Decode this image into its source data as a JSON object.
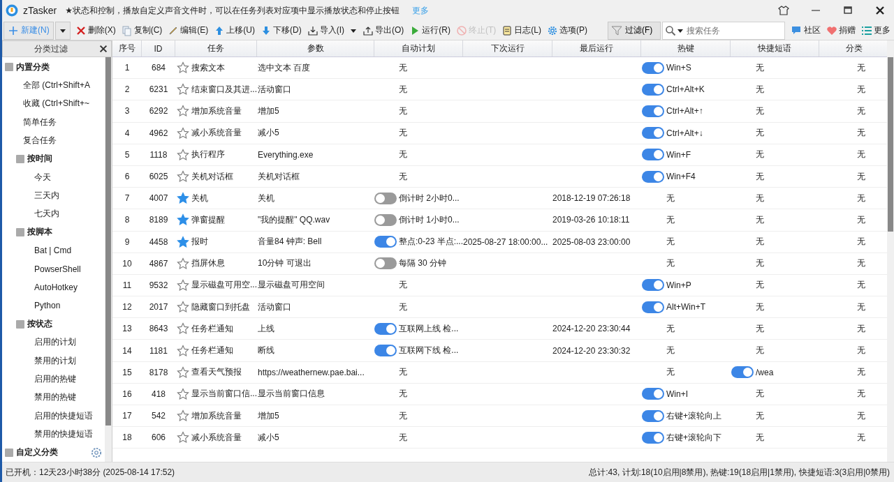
{
  "window": {
    "app_name": "zTasker",
    "news": "★状态和控制，播放自定义声音文件时，可以在任务列表对应项中显示播放状态和停止按钮",
    "news_link": "更多"
  },
  "toolbar": {
    "items": [
      {
        "label": "新建(N)",
        "disabled": false
      },
      {
        "label": "删除(X)",
        "disabled": false
      },
      {
        "label": "复制(C)",
        "disabled": false
      },
      {
        "label": "编辑(E)",
        "disabled": false
      },
      {
        "label": "上移(U)",
        "disabled": false
      },
      {
        "label": "下移(D)",
        "disabled": false
      },
      {
        "label": "导入(I)",
        "disabled": false
      },
      {
        "label": "导出(O)",
        "disabled": false
      },
      {
        "label": "运行(R)",
        "disabled": false
      },
      {
        "label": "终止(T)",
        "disabled": true
      },
      {
        "label": "日志(L)",
        "disabled": false
      },
      {
        "label": "选项(P)",
        "disabled": false
      }
    ],
    "filter": "过滤(F)",
    "search_placeholder": "搜索任务",
    "links": [
      "社区",
      "捐赠",
      "更多"
    ]
  },
  "sidebar": {
    "title": "分类过滤",
    "tree": [
      {
        "label": "内置分类",
        "children": [
          {
            "label": "全部 (Ctrl+Shift+A"
          },
          {
            "label": "收藏 (Ctrl+Shift+~"
          },
          {
            "label": "简单任务"
          },
          {
            "label": "复合任务"
          },
          {
            "label": "按时间",
            "children": [
              {
                "label": "今天"
              },
              {
                "label": "三天内"
              },
              {
                "label": "七天内"
              }
            ]
          },
          {
            "label": "按脚本",
            "children": [
              {
                "label": "Bat | Cmd"
              },
              {
                "label": "PowserShell"
              },
              {
                "label": "AutoHotkey"
              },
              {
                "label": "Python"
              }
            ]
          },
          {
            "label": "按状态",
            "children": [
              {
                "label": "启用的计划"
              },
              {
                "label": "禁用的计划"
              },
              {
                "label": "启用的热键"
              },
              {
                "label": "禁用的热键"
              },
              {
                "label": "启用的快捷短语"
              },
              {
                "label": "禁用的快捷短语"
              }
            ]
          }
        ]
      },
      {
        "label": "自定义分类"
      }
    ]
  },
  "table": {
    "columns": [
      "序号",
      "ID",
      "任务",
      "参数",
      "自动计划",
      "下次运行",
      "最后运行",
      "热键",
      "快捷短语",
      "分类"
    ],
    "rows": [
      {
        "no": "1",
        "id": "684",
        "starred": false,
        "task": "搜索文本",
        "param": "选中文本 百度",
        "plan": {
          "text": "无"
        },
        "next": "",
        "last": "",
        "hotkey": {
          "on": true,
          "text": "Win+S"
        },
        "phrase": {
          "text": "无"
        },
        "category": "无"
      },
      {
        "no": "2",
        "id": "6231",
        "starred": false,
        "task": "结束窗口及其进...",
        "param": "活动窗口",
        "plan": {
          "text": "无"
        },
        "next": "",
        "last": "",
        "hotkey": {
          "on": true,
          "text": "Ctrl+Alt+K"
        },
        "phrase": {
          "text": "无"
        },
        "category": "无"
      },
      {
        "no": "3",
        "id": "6292",
        "starred": false,
        "task": "增加系统音量",
        "param": "增加5",
        "plan": {
          "text": "无"
        },
        "next": "",
        "last": "",
        "hotkey": {
          "on": true,
          "text": "Ctrl+Alt+↑"
        },
        "phrase": {
          "text": "无"
        },
        "category": "无"
      },
      {
        "no": "4",
        "id": "4962",
        "starred": false,
        "task": "减小系统音量",
        "param": "减小5",
        "plan": {
          "text": "无"
        },
        "next": "",
        "last": "",
        "hotkey": {
          "on": true,
          "text": "Ctrl+Alt+↓"
        },
        "phrase": {
          "text": "无"
        },
        "category": "无"
      },
      {
        "no": "5",
        "id": "1118",
        "starred": false,
        "task": "执行程序",
        "param": "Everything.exe",
        "plan": {
          "text": "无"
        },
        "next": "",
        "last": "",
        "hotkey": {
          "on": true,
          "text": "Win+F"
        },
        "phrase": {
          "text": "无"
        },
        "category": "无"
      },
      {
        "no": "6",
        "id": "6025",
        "starred": false,
        "task": "关机对话框",
        "param": "关机对话框",
        "plan": {
          "text": "无"
        },
        "next": "",
        "last": "",
        "hotkey": {
          "on": true,
          "text": "Win+F4"
        },
        "phrase": {
          "text": "无"
        },
        "category": "无"
      },
      {
        "no": "7",
        "id": "4007",
        "starred": true,
        "task": "关机",
        "param": "关机",
        "plan": {
          "on": false,
          "text": "倒计时 2小时0..."
        },
        "next": "",
        "last": "2018-12-19 07:26:18",
        "hotkey": {
          "text": "无"
        },
        "phrase": {
          "text": "无"
        },
        "category": "无"
      },
      {
        "no": "8",
        "id": "8189",
        "starred": true,
        "task": "弹窗提醒",
        "param": "\"我的提醒\" QQ.wav",
        "plan": {
          "on": false,
          "text": "倒计时 1小时0..."
        },
        "next": "",
        "last": "2019-03-26 10:18:11",
        "hotkey": {
          "text": "无"
        },
        "phrase": {
          "text": "无"
        },
        "category": "无"
      },
      {
        "no": "9",
        "id": "4458",
        "starred": true,
        "task": "报时",
        "param": "音量84 钟声: Bell",
        "plan": {
          "on": true,
          "text": "整点:0-23 半点:..."
        },
        "next": "2025-08-27 18:00:00...",
        "last": "2025-08-03 23:00:00",
        "hotkey": {
          "text": "无"
        },
        "phrase": {
          "text": "无"
        },
        "category": "无"
      },
      {
        "no": "10",
        "id": "4867",
        "starred": false,
        "task": "挡屏休息",
        "param": "10分钟 可退出",
        "plan": {
          "on": false,
          "text": "每隔 30 分钟"
        },
        "next": "",
        "last": "",
        "hotkey": {
          "text": "无"
        },
        "phrase": {
          "text": "无"
        },
        "category": "无"
      },
      {
        "no": "11",
        "id": "9532",
        "starred": false,
        "task": "显示磁盘可用空...",
        "param": "显示磁盘可用空间",
        "plan": {
          "text": "无"
        },
        "next": "",
        "last": "",
        "hotkey": {
          "on": true,
          "text": "Win+P"
        },
        "phrase": {
          "text": "无"
        },
        "category": "无"
      },
      {
        "no": "12",
        "id": "2017",
        "starred": false,
        "task": "隐藏窗口到托盘",
        "param": "活动窗口",
        "plan": {
          "text": "无"
        },
        "next": "",
        "last": "",
        "hotkey": {
          "on": true,
          "text": "Alt+Win+T"
        },
        "phrase": {
          "text": "无"
        },
        "category": "无"
      },
      {
        "no": "13",
        "id": "8643",
        "starred": false,
        "task": "任务栏通知",
        "param": "上线",
        "plan": {
          "on": true,
          "text": "互联网上线 检..."
        },
        "next": "",
        "last": "2024-12-20 23:30:44",
        "hotkey": {
          "text": "无"
        },
        "phrase": {
          "text": "无"
        },
        "category": "无"
      },
      {
        "no": "14",
        "id": "1181",
        "starred": false,
        "task": "任务栏通知",
        "param": "断线",
        "plan": {
          "on": true,
          "text": "互联网下线 检..."
        },
        "next": "",
        "last": "2024-12-20 23:30:32",
        "hotkey": {
          "text": "无"
        },
        "phrase": {
          "text": "无"
        },
        "category": "无"
      },
      {
        "no": "15",
        "id": "8178",
        "starred": false,
        "task": "查看天气预报",
        "param": "https://weathernew.pae.bai...",
        "plan": {
          "text": "无"
        },
        "next": "",
        "last": "",
        "hotkey": {
          "text": "无"
        },
        "phrase": {
          "on": true,
          "text": "/wea"
        },
        "category": "无"
      },
      {
        "no": "16",
        "id": "418",
        "starred": false,
        "task": "显示当前窗口信...",
        "param": "显示当前窗口信息",
        "plan": {
          "text": "无"
        },
        "next": "",
        "last": "",
        "hotkey": {
          "on": true,
          "text": "Win+I"
        },
        "phrase": {
          "text": "无"
        },
        "category": "无"
      },
      {
        "no": "17",
        "id": "542",
        "starred": false,
        "task": "增加系统音量",
        "param": "增加5",
        "plan": {
          "text": "无"
        },
        "next": "",
        "last": "",
        "hotkey": {
          "on": true,
          "text": "右键+滚轮向上"
        },
        "phrase": {
          "text": "无"
        },
        "category": "无"
      },
      {
        "no": "18",
        "id": "606",
        "starred": false,
        "task": "减小系统音量",
        "param": "减小5",
        "plan": {
          "text": "无"
        },
        "next": "",
        "last": "",
        "hotkey": {
          "on": true,
          "text": "右键+滚轮向下"
        },
        "phrase": {
          "text": "无"
        },
        "category": "无"
      }
    ]
  },
  "status_bar": {
    "uptime": "已开机：12天23小时38分 (2025-08-14 17:52)",
    "summary": "总计:43, 计划:18(10启用|8禁用), 热键:19(18启用|1禁用), 快捷短语:3(3启用|0禁用)"
  }
}
